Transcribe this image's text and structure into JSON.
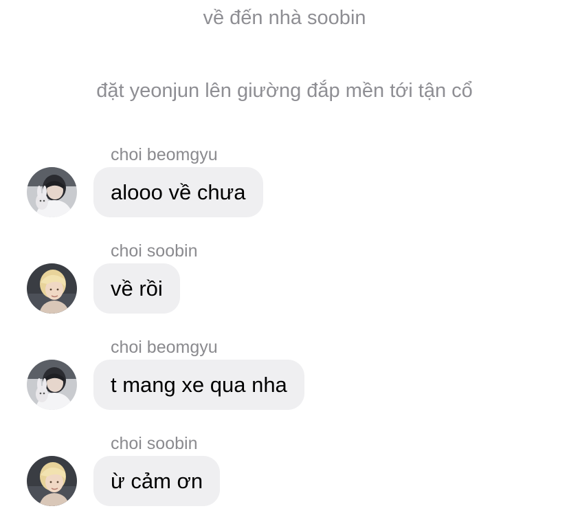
{
  "system_messages": [
    "về đến nhà soobin",
    "đặt yeonjun lên giường đắp mền tới tận cổ"
  ],
  "messages": [
    {
      "sender": "choi beomgyu",
      "text": "alooo về chưa",
      "avatar_icon": "beomgyu-avatar"
    },
    {
      "sender": "choi soobin",
      "text": "về rồi",
      "avatar_icon": "soobin-avatar"
    },
    {
      "sender": "choi beomgyu",
      "text": "t mang xe qua nha",
      "avatar_icon": "beomgyu-avatar"
    },
    {
      "sender": "choi soobin",
      "text": "ừ cảm ơn",
      "avatar_icon": "soobin-avatar"
    }
  ],
  "colors": {
    "system_text": "#8e8e93",
    "sender_name": "#8a8a8e",
    "bubble_background": "#efeff1",
    "message_text": "#000000"
  }
}
